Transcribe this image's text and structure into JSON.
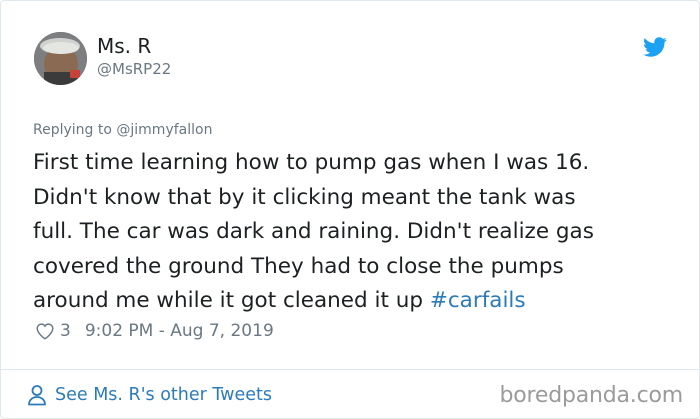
{
  "author": {
    "display_name": "Ms. R",
    "handle": "@MsRP22"
  },
  "reply": {
    "prefix": "Replying to",
    "to": "@jimmyfallon"
  },
  "tweet": {
    "text": "First time learning how to pump gas when I was 16.\nDidn't know that by it clicking meant the tank was\nfull. The car was dark and raining. Didn't realize gas\ncovered the ground They had to close the pumps\naround me while it got cleaned it up ",
    "hashtag": "#carfails"
  },
  "meta": {
    "likes": "3",
    "timestamp": "9:02 PM - Aug 7, 2019"
  },
  "footer": {
    "see_more": "See Ms. R's other Tweets",
    "watermark": "boredpanda.com"
  },
  "colors": {
    "link": "#2b7bb9",
    "muted": "#697882",
    "twitter_blue": "#1da1f2"
  }
}
